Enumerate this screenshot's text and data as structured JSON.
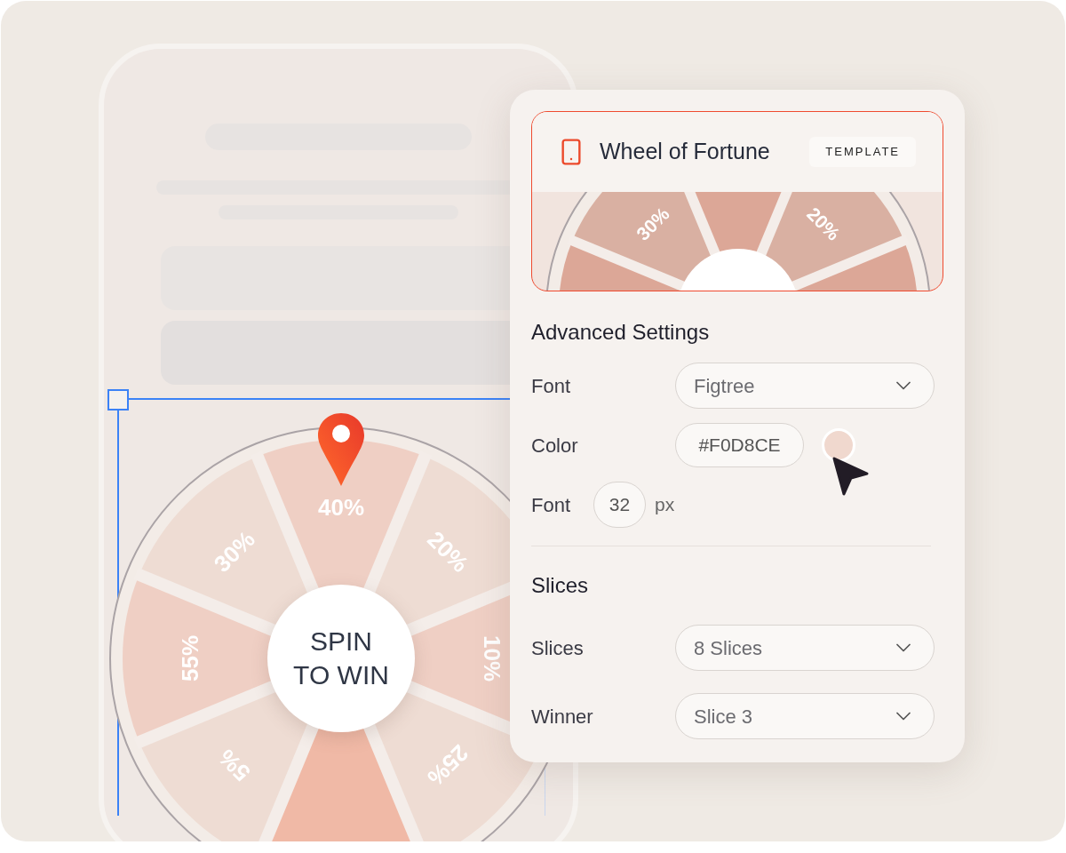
{
  "wheel": {
    "spin_button": [
      "SPIN",
      "TO WIN"
    ],
    "slices": [
      {
        "label": "40%",
        "highlighted": false
      },
      {
        "label": "20%",
        "highlighted": false
      },
      {
        "label": "10%",
        "highlighted": false
      },
      {
        "label": "25%",
        "highlighted": false
      },
      {
        "highlighted": true
      },
      {
        "label": "5%",
        "highlighted": false
      },
      {
        "label": "55%",
        "highlighted": false
      },
      {
        "label": "30%",
        "highlighted": false
      }
    ]
  },
  "panel": {
    "title": "Wheel of Fortune",
    "badge": "TEMPLATE",
    "preview_labels": [
      "30%",
      "20%"
    ],
    "advanced_heading": "Advanced Settings",
    "font_label": "Font",
    "font_value": "Figtree",
    "color_label": "Color",
    "color_value": "#F0D8CE",
    "color": "#f0d8ce",
    "size_label": "Font",
    "size_value": "32",
    "size_unit": "px",
    "slices_heading": "Slices",
    "slices_label": "Slices",
    "slices_value": "8 Slices",
    "winner_label": "Winner",
    "winner_value": "Slice 3"
  }
}
